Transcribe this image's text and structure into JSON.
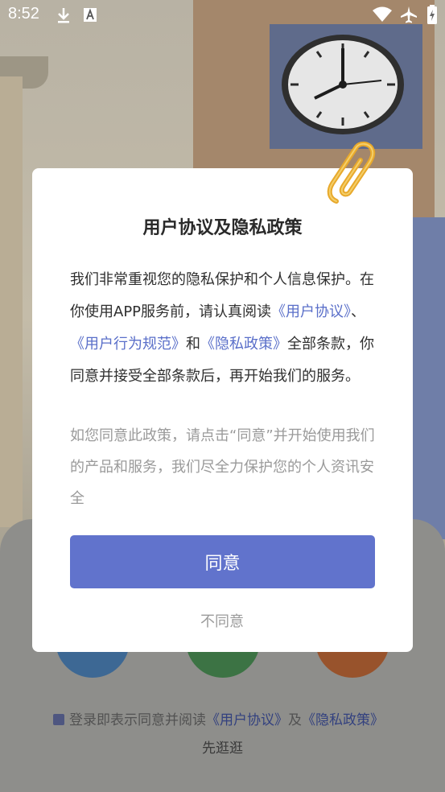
{
  "status_bar": {
    "time": "8:52",
    "icons": [
      "download-icon",
      "text-a-icon",
      "wifi-icon",
      "airplane-icon",
      "battery-charging-icon"
    ]
  },
  "dialog": {
    "title": "用户协议及隐私政策",
    "body": {
      "part1": "我们非常重视您的隐私保护和个人信息保护。在你使用APP服务前，请认真阅读",
      "link1": "《用户协议》",
      "sep1": "、",
      "link2": "《用户行为规范》",
      "sep2": "和",
      "link3": "《隐私政策》",
      "part2": "全部条款，你同意并接受全部条款后，再开始我们的服务。"
    },
    "note": "如您同意此政策，请点击“同意”并开始使用我们的产品和服务，我们尽全力保护您的个人资讯安全",
    "agree_label": "同意",
    "disagree_label": "不同意"
  },
  "footer": {
    "agree_prefix": "登录即表示同意并阅读",
    "user_agreement_link": "《用户协议》",
    "and": "及",
    "privacy_link": "《隐私政策》",
    "browse_label": "先逛逛"
  },
  "colors": {
    "accent": "#6173cc",
    "link": "#5a6fc9",
    "note_text": "#9a9a9a"
  }
}
